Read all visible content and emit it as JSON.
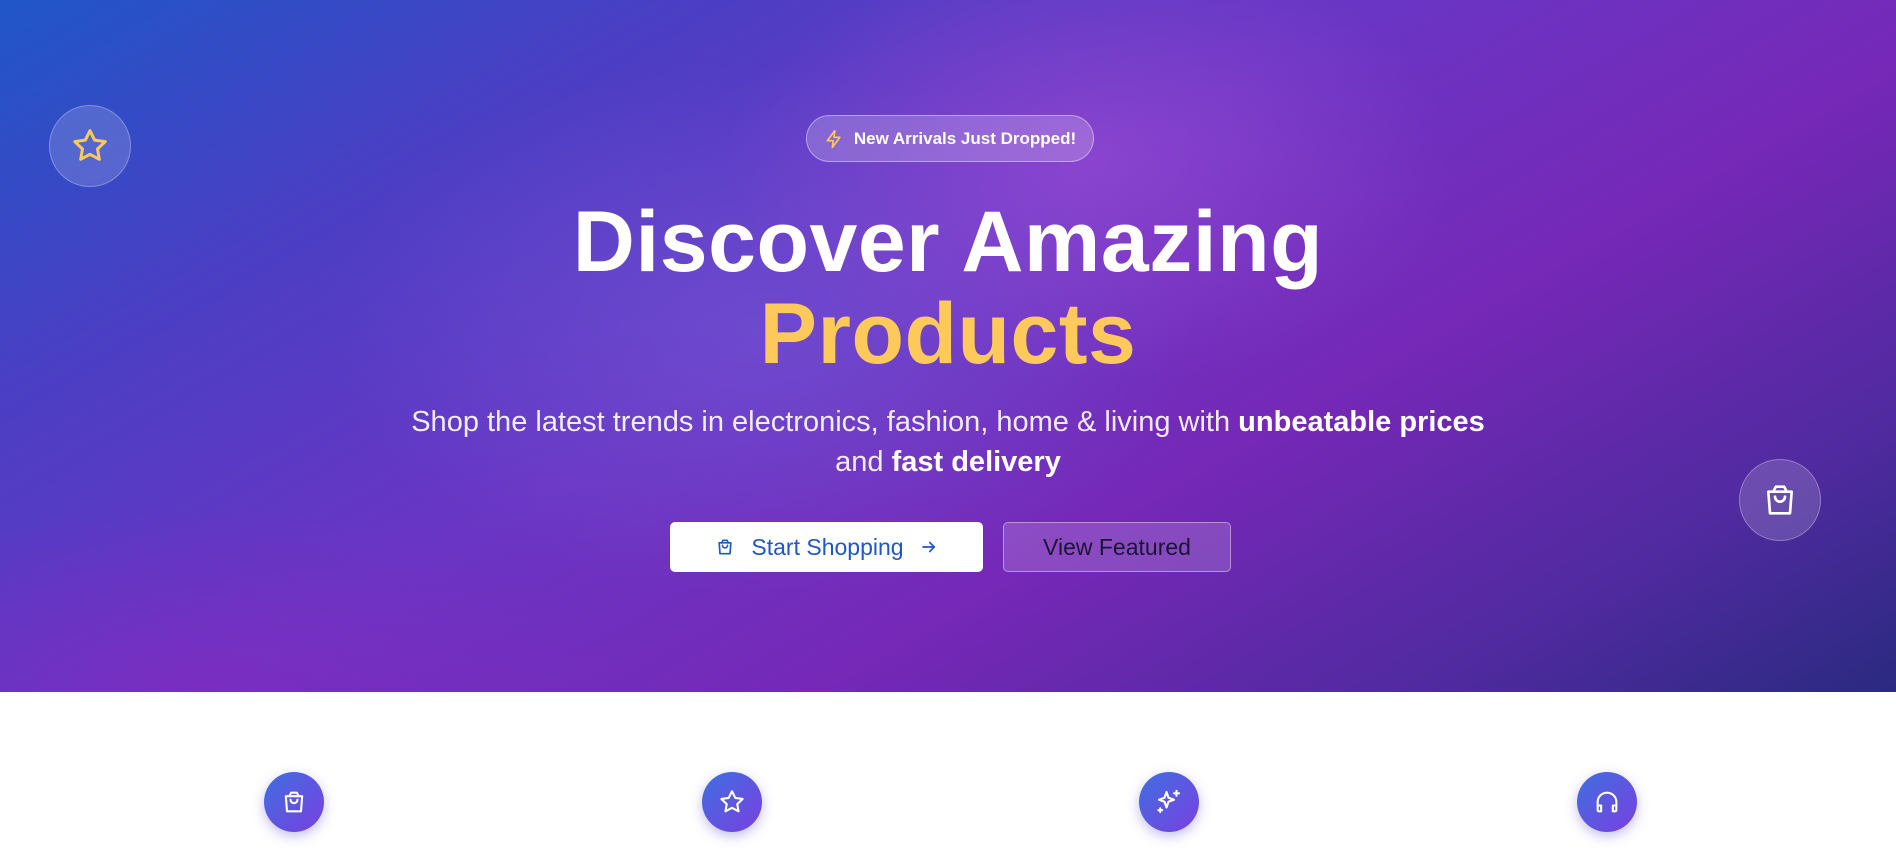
{
  "hero": {
    "badge_icon": "zap-icon",
    "badge_text": "New Arrivals Just Dropped!",
    "headline_line1": "Discover Amazing",
    "headline_line2": "Products",
    "subtitle_part1": "Shop the latest trends in electronics, fashion, home & living with ",
    "subtitle_strong1": "unbeatable prices",
    "subtitle_part2": " and ",
    "subtitle_strong2": "fast delivery",
    "primary_button_label": "Start Shopping",
    "secondary_button_label": "View Featured",
    "floating_icons": [
      "star-icon",
      "shopping-bag-icon"
    ]
  },
  "features": {
    "icons": [
      "shopping-bag-icon",
      "star-icon",
      "sparkles-icon",
      "headphones-icon"
    ]
  },
  "colors": {
    "accent_yellow": "#fcc95a",
    "primary_blue": "#1f56c8",
    "hero_purple": "#7628b7"
  }
}
